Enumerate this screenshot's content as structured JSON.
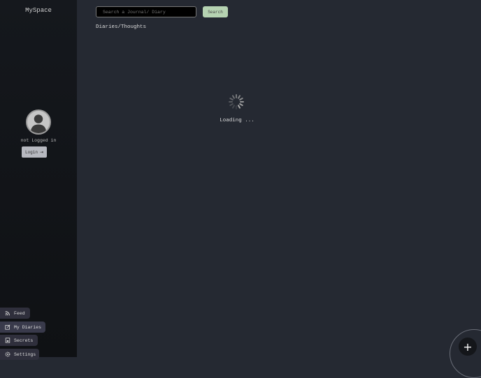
{
  "sidebar": {
    "brand": "MySpace",
    "status": "not Logged in",
    "login_label": "Login",
    "nav": [
      {
        "label": "Feed",
        "icon": "rss-icon"
      },
      {
        "label": "My Diaries",
        "icon": "edit-icon"
      },
      {
        "label": "Secrets",
        "icon": "lock-file-icon"
      },
      {
        "label": "Settings",
        "icon": "gear-icon"
      }
    ]
  },
  "main": {
    "search_placeholder": "Search a Journal/ Diary",
    "search_label": "Search",
    "heading": "Diaries/Thoughts",
    "loading": "Loading ...",
    "fab_label": "+"
  }
}
